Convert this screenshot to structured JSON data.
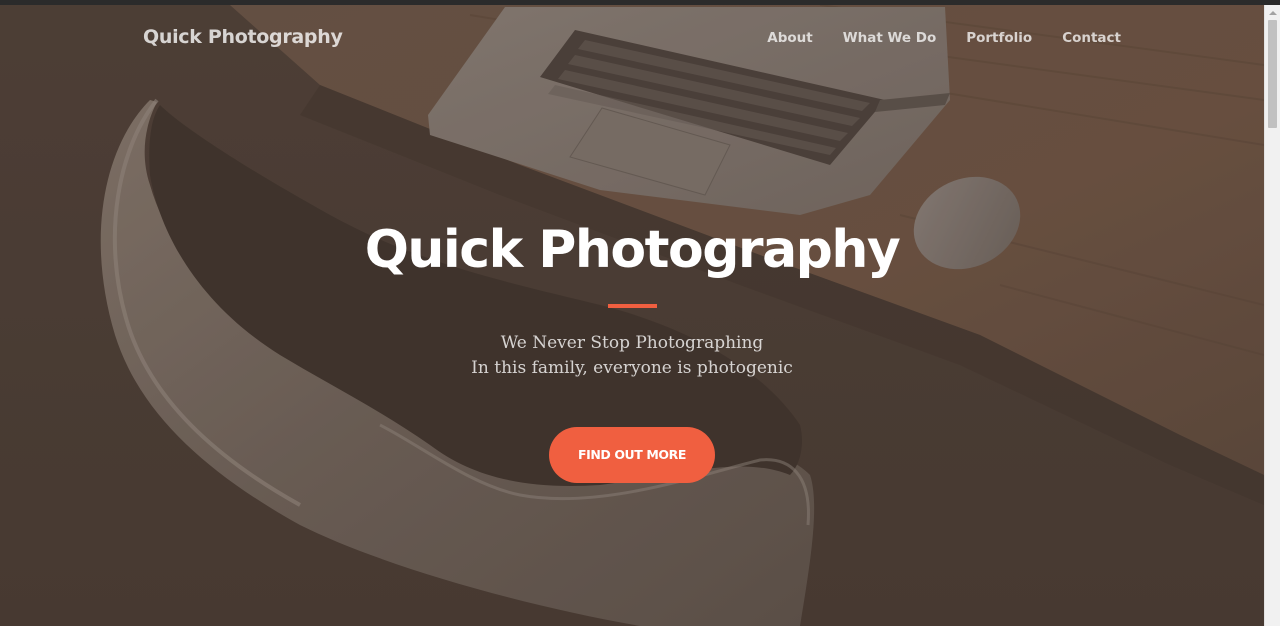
{
  "navbar": {
    "brand": "Quick Photography",
    "items": [
      {
        "label": "About"
      },
      {
        "label": "What We Do"
      },
      {
        "label": "Portfolio"
      },
      {
        "label": "Contact"
      }
    ]
  },
  "hero": {
    "title": "Quick Photography",
    "subtitle_line1": "We Never Stop Photographing",
    "subtitle_line2": "In this family, everyone is photogenic",
    "cta_label": "Find Out More",
    "background_image": "desk-with-laptop-mouse-and-chair-photo"
  },
  "colors": {
    "accent": "#f05f40",
    "overlay": "#4d3f37",
    "text": "#ffffff"
  }
}
